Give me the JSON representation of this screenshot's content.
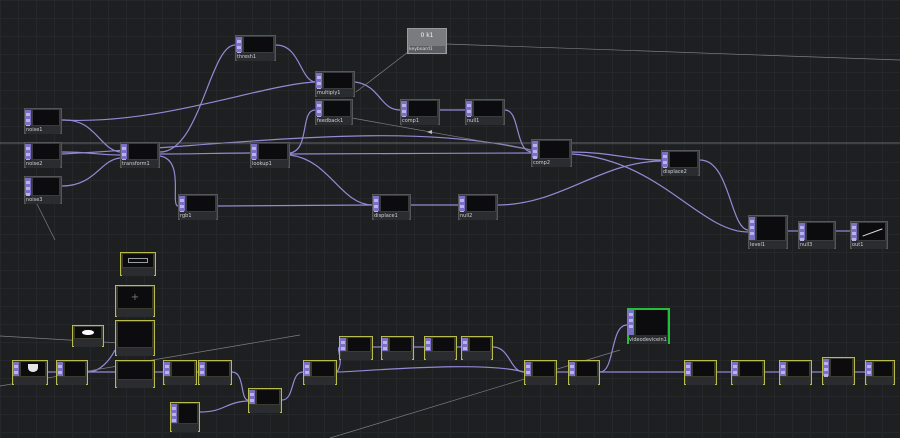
{
  "editor": {
    "colors": {
      "background": "#1e1f21",
      "wire": "#9489d6",
      "wire_light": "#b3aee6",
      "dat_border": "#b9bb4a",
      "selected_border": "#22c03a",
      "input_strip": "#7c6fc6"
    }
  },
  "nodes": {
    "keyboard": {
      "label": "keyboard1",
      "value": "0 k1",
      "icon": "keyboard-icon"
    },
    "thresh": {
      "label": "thresh1"
    },
    "multiply": {
      "label": "multiply1"
    },
    "feedback": {
      "label": "feedback1"
    },
    "comp1": {
      "label": "comp1"
    },
    "null1": {
      "label": "null1"
    },
    "comp2": {
      "label": "comp2"
    },
    "noise1": {
      "label": "noise1"
    },
    "noise2": {
      "label": "noise2"
    },
    "noise3": {
      "label": "noise3"
    },
    "transform": {
      "label": "transform1"
    },
    "rgb": {
      "label": "rgb1"
    },
    "lookup": {
      "label": "lookup1"
    },
    "displace": {
      "label": "displace1"
    },
    "null2": {
      "label": "null2"
    },
    "displace2": {
      "label": "displace2"
    },
    "level": {
      "label": "level1"
    },
    "null3": {
      "label": "null3"
    },
    "out1": {
      "label": "out1"
    },
    "b_gray": {
      "label": ""
    },
    "b_cross": {
      "label": ""
    },
    "b_blob": {
      "label": ""
    },
    "b_stars": {
      "label": ""
    },
    "b_shield": {
      "label": ""
    },
    "b_in2": {
      "label": ""
    },
    "b_main": {
      "label": ""
    },
    "b_n5": {
      "label": ""
    },
    "b_n6": {
      "label": ""
    },
    "b_grad": {
      "label": ""
    },
    "b_merge": {
      "label": ""
    },
    "b_r1": {
      "label": ""
    },
    "b_r2": {
      "label": ""
    },
    "b_r3": {
      "label": ""
    },
    "b_r4": {
      "label": ""
    },
    "b_r5": {
      "label": ""
    },
    "b_r6": {
      "label": ""
    },
    "b_r7": {
      "label": ""
    },
    "b_sel": {
      "label": "videodevicein1"
    },
    "b_r8": {
      "label": ""
    },
    "b_r9": {
      "label": ""
    },
    "b_r10": {
      "label": ""
    },
    "b_r11": {
      "label": ""
    },
    "b_r12": {
      "label": ""
    }
  }
}
